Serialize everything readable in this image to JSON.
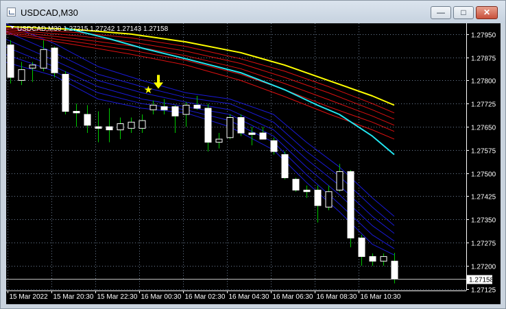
{
  "window": {
    "title": "USDCAD,M30",
    "minimize_label": "—",
    "maximize_label": "□",
    "close_label": "✕"
  },
  "chart_header": {
    "label": "USDCAD,M30  1.27215 1.27242 1.27143 1.27158"
  },
  "chart_data": {
    "type": "candlestick",
    "title": "USDCAD,M30",
    "ylim": [
      1.2712,
      1.27985
    ],
    "y_ticks": [
      "1.27950",
      "1.27875",
      "1.27800",
      "1.27725",
      "1.27650",
      "1.27575",
      "1.27500",
      "1.27425",
      "1.27350",
      "1.27275",
      "1.27200",
      "1.27125"
    ],
    "x_ticks": [
      "15 Mar 2022",
      "15 Mar 20:30",
      "15 Mar 22:30",
      "16 Mar 00:30",
      "16 Mar 02:30",
      "16 Mar 04:30",
      "16 Mar 06:30",
      "16 Mar 08:30",
      "16 Mar 10:30"
    ],
    "current_price": "1.27158",
    "grid": true,
    "background": "#000000",
    "colors": {
      "grid": "#6e7f96",
      "axis": "#ffffff",
      "bull_body": "#000000",
      "bear_body": "#ffffff",
      "wick": "#00c800",
      "gold_line": "#ffff00",
      "red_lines": "#e01010",
      "cyan_line": "#22e6f0",
      "blue_lines": "#1a1ad8",
      "marker": "#ffff00"
    },
    "candles": [
      {
        "o": 1.27915,
        "h": 1.2793,
        "l": 1.2779,
        "c": 1.2781
      },
      {
        "o": 1.278,
        "h": 1.2786,
        "l": 1.27785,
        "c": 1.27835
      },
      {
        "o": 1.2784,
        "h": 1.2786,
        "l": 1.27795,
        "c": 1.2785
      },
      {
        "o": 1.2784,
        "h": 1.2793,
        "l": 1.2783,
        "c": 1.279
      },
      {
        "o": 1.27905,
        "h": 1.2791,
        "l": 1.2781,
        "c": 1.27825
      },
      {
        "o": 1.2782,
        "h": 1.2783,
        "l": 1.2769,
        "c": 1.277
      },
      {
        "o": 1.277,
        "h": 1.27725,
        "l": 1.2765,
        "c": 1.27695
      },
      {
        "o": 1.2769,
        "h": 1.2772,
        "l": 1.2763,
        "c": 1.27655
      },
      {
        "o": 1.2765,
        "h": 1.277,
        "l": 1.276,
        "c": 1.27645
      },
      {
        "o": 1.2765,
        "h": 1.2771,
        "l": 1.276,
        "c": 1.2764
      },
      {
        "o": 1.2764,
        "h": 1.2768,
        "l": 1.2761,
        "c": 1.2766
      },
      {
        "o": 1.27645,
        "h": 1.2768,
        "l": 1.2763,
        "c": 1.27665
      },
      {
        "o": 1.27645,
        "h": 1.2769,
        "l": 1.2763,
        "c": 1.2767
      },
      {
        "o": 1.27705,
        "h": 1.27735,
        "l": 1.2769,
        "c": 1.2772
      },
      {
        "o": 1.27715,
        "h": 1.2774,
        "l": 1.2769,
        "c": 1.27705
      },
      {
        "o": 1.27715,
        "h": 1.2772,
        "l": 1.2763,
        "c": 1.27685
      },
      {
        "o": 1.2769,
        "h": 1.2773,
        "l": 1.2765,
        "c": 1.2772
      },
      {
        "o": 1.2772,
        "h": 1.2775,
        "l": 1.27705,
        "c": 1.2771
      },
      {
        "o": 1.2771,
        "h": 1.27725,
        "l": 1.2757,
        "c": 1.276
      },
      {
        "o": 1.276,
        "h": 1.2763,
        "l": 1.2758,
        "c": 1.2761
      },
      {
        "o": 1.27615,
        "h": 1.2769,
        "l": 1.2761,
        "c": 1.2768
      },
      {
        "o": 1.2768,
        "h": 1.2769,
        "l": 1.2762,
        "c": 1.2763
      },
      {
        "o": 1.2763,
        "h": 1.2765,
        "l": 1.2759,
        "c": 1.27625
      },
      {
        "o": 1.2763,
        "h": 1.2765,
        "l": 1.2761,
        "c": 1.2761
      },
      {
        "o": 1.27605,
        "h": 1.27615,
        "l": 1.2756,
        "c": 1.2757
      },
      {
        "o": 1.2756,
        "h": 1.2757,
        "l": 1.2748,
        "c": 1.27485
      },
      {
        "o": 1.2748,
        "h": 1.27485,
        "l": 1.2744,
        "c": 1.27445
      },
      {
        "o": 1.27445,
        "h": 1.2746,
        "l": 1.2742,
        "c": 1.2744
      },
      {
        "o": 1.27445,
        "h": 1.2746,
        "l": 1.2734,
        "c": 1.27395
      },
      {
        "o": 1.2739,
        "h": 1.2746,
        "l": 1.2738,
        "c": 1.2744
      },
      {
        "o": 1.27445,
        "h": 1.2753,
        "l": 1.2744,
        "c": 1.27505
      },
      {
        "o": 1.27505,
        "h": 1.2751,
        "l": 1.2726,
        "c": 1.2729
      },
      {
        "o": 1.2729,
        "h": 1.273,
        "l": 1.272,
        "c": 1.2723
      },
      {
        "o": 1.2723,
        "h": 1.2724,
        "l": 1.272,
        "c": 1.27215
      },
      {
        "o": 1.27215,
        "h": 1.2724,
        "l": 1.272,
        "c": 1.2723
      },
      {
        "o": 1.27215,
        "h": 1.27242,
        "l": 1.27143,
        "c": 1.27158
      }
    ],
    "gold_line": [
      [
        -7.6,
        1.27985
      ],
      [
        6,
        1.27965
      ],
      [
        11,
        1.2795
      ],
      [
        16,
        1.27925
      ],
      [
        21,
        1.2789
      ],
      [
        25,
        1.2785
      ],
      [
        29,
        1.278
      ],
      [
        33,
        1.2775
      ],
      [
        35,
        1.2772
      ]
    ],
    "red_lines": [
      [
        [
          -7.3,
          1.27985
        ],
        [
          6,
          1.27955
        ],
        [
          11,
          1.27938
        ],
        [
          16,
          1.2791
        ],
        [
          21,
          1.2787
        ],
        [
          25,
          1.2783
        ],
        [
          29,
          1.2778
        ],
        [
          33,
          1.27725
        ],
        [
          35,
          1.27695
        ]
      ],
      [
        [
          -7.0,
          1.27985
        ],
        [
          6,
          1.27945
        ],
        [
          11,
          1.27925
        ],
        [
          16,
          1.27895
        ],
        [
          21,
          1.27855
        ],
        [
          25,
          1.2781
        ],
        [
          29,
          1.2776
        ],
        [
          33,
          1.27705
        ],
        [
          35,
          1.27675
        ]
      ],
      [
        [
          -6.7,
          1.27985
        ],
        [
          6,
          1.27935
        ],
        [
          11,
          1.27912
        ],
        [
          16,
          1.2788
        ],
        [
          21,
          1.27838
        ],
        [
          25,
          1.2779
        ],
        [
          29,
          1.27738
        ],
        [
          33,
          1.27685
        ],
        [
          35,
          1.27655
        ]
      ],
      [
        [
          -6.4,
          1.27985
        ],
        [
          6,
          1.27925
        ],
        [
          11,
          1.27898
        ],
        [
          16,
          1.27865
        ],
        [
          21,
          1.2782
        ],
        [
          25,
          1.2777
        ],
        [
          29,
          1.27715
        ],
        [
          33,
          1.27665
        ],
        [
          35,
          1.27635
        ]
      ],
      [
        [
          -6.1,
          1.27985
        ],
        [
          6,
          1.27915
        ],
        [
          11,
          1.27885
        ],
        [
          16,
          1.2785
        ],
        [
          21,
          1.278
        ],
        [
          25,
          1.27748
        ],
        [
          29,
          1.27692
        ],
        [
          33,
          1.2764
        ],
        [
          35,
          1.2761
        ]
      ]
    ],
    "cyan_line": [
      [
        5,
        1.2797
      ],
      [
        9,
        1.27935
      ],
      [
        12,
        1.27905
      ],
      [
        16,
        1.2787
      ],
      [
        21,
        1.27825
      ],
      [
        25,
        1.2777
      ],
      [
        28,
        1.2772
      ],
      [
        30,
        1.2769
      ],
      [
        33,
        1.2762
      ],
      [
        35,
        1.2756
      ]
    ],
    "blue_lines": [
      [
        [
          -0.5,
          1.27985
        ],
        [
          4,
          1.2792
        ],
        [
          8,
          1.27845
        ],
        [
          12,
          1.278
        ],
        [
          16,
          1.2776
        ],
        [
          20,
          1.2774
        ],
        [
          24,
          1.2769
        ],
        [
          27,
          1.276
        ],
        [
          30,
          1.2752
        ],
        [
          33,
          1.2742
        ],
        [
          35,
          1.2736
        ]
      ],
      [
        [
          -0.5,
          1.2796
        ],
        [
          4,
          1.2789
        ],
        [
          8,
          1.2782
        ],
        [
          12,
          1.2778
        ],
        [
          16,
          1.27745
        ],
        [
          20,
          1.27725
        ],
        [
          24,
          1.27665
        ],
        [
          27,
          1.2757
        ],
        [
          30,
          1.2749
        ],
        [
          33,
          1.2739
        ],
        [
          35,
          1.2733
        ]
      ],
      [
        [
          -0.5,
          1.27935
        ],
        [
          4,
          1.27865
        ],
        [
          8,
          1.278
        ],
        [
          12,
          1.2776
        ],
        [
          16,
          1.2773
        ],
        [
          20,
          1.27705
        ],
        [
          24,
          1.2764
        ],
        [
          27,
          1.27545
        ],
        [
          30,
          1.2746
        ],
        [
          33,
          1.2736
        ],
        [
          35,
          1.27305
        ]
      ],
      [
        [
          -0.5,
          1.2791
        ],
        [
          4,
          1.27845
        ],
        [
          8,
          1.2778
        ],
        [
          12,
          1.2774
        ],
        [
          16,
          1.27715
        ],
        [
          20,
          1.2769
        ],
        [
          24,
          1.2762
        ],
        [
          27,
          1.2752
        ],
        [
          30,
          1.2743
        ],
        [
          33,
          1.2733
        ],
        [
          35,
          1.2728
        ]
      ],
      [
        [
          -0.5,
          1.27885
        ],
        [
          4,
          1.2783
        ],
        [
          8,
          1.2776
        ],
        [
          12,
          1.27725
        ],
        [
          16,
          1.27705
        ],
        [
          20,
          1.2767
        ],
        [
          24,
          1.276
        ],
        [
          27,
          1.27495
        ],
        [
          30,
          1.274
        ],
        [
          33,
          1.273
        ],
        [
          35,
          1.27255
        ]
      ],
      [
        [
          -0.5,
          1.2786
        ],
        [
          4,
          1.27815
        ],
        [
          8,
          1.2774
        ],
        [
          12,
          1.2771
        ],
        [
          16,
          1.27695
        ],
        [
          20,
          1.2765
        ],
        [
          24,
          1.27575
        ],
        [
          27,
          1.2747
        ],
        [
          30,
          1.27375
        ],
        [
          33,
          1.2727
        ],
        [
          35,
          1.27235
        ]
      ]
    ],
    "markers": [
      {
        "type": "star",
        "index": 12.6,
        "value": 1.2777
      },
      {
        "type": "down-arrow",
        "index": 13.5,
        "value": 1.2778
      }
    ]
  }
}
